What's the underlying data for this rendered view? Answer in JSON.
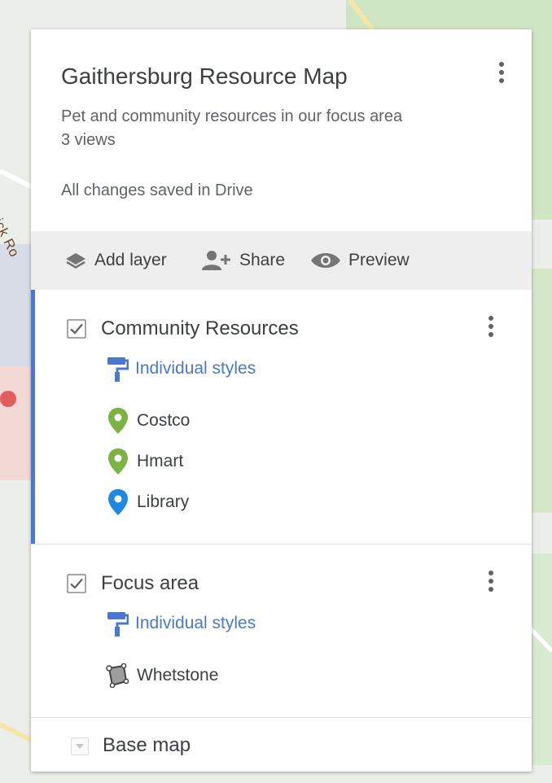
{
  "map": {
    "road_label": "derick Ro"
  },
  "panel": {
    "title": "Gaithersburg Resource Map",
    "subtitle": "Pet and community resources in our focus area",
    "views": "3 views",
    "saved_status": "All changes saved in Drive"
  },
  "toolbar": {
    "add_layer": "Add layer",
    "share": "Share",
    "preview": "Preview"
  },
  "layers": [
    {
      "name": "Community Resources",
      "checked": true,
      "styles_label": "Individual styles",
      "items": [
        {
          "label": "Costco",
          "icon": "green-pin-icon",
          "color": "#7cb342"
        },
        {
          "label": "Hmart",
          "icon": "green-pin-icon",
          "color": "#7cb342"
        },
        {
          "label": "Library",
          "icon": "blue-pin-icon",
          "color": "#1e88e5"
        }
      ]
    },
    {
      "name": "Focus area",
      "checked": true,
      "styles_label": "Individual styles",
      "items": [
        {
          "label": "Whetstone",
          "icon": "polygon-icon",
          "color": "#616161"
        }
      ]
    }
  ],
  "basemap": {
    "label": "Base map"
  },
  "colors": {
    "accent": "#4a78d0",
    "link": "#4a78d0",
    "toolbar_bg": "#eeeeee"
  }
}
